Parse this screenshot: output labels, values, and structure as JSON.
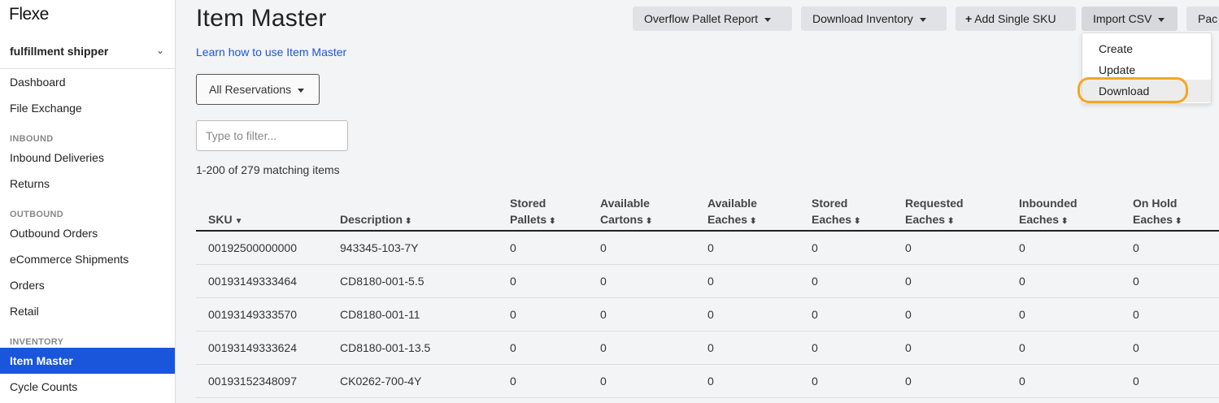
{
  "sidebar": {
    "logo": "Flexe",
    "account": "fulfillment shipper",
    "items_top": [
      "Dashboard",
      "File Exchange"
    ],
    "section_inbound": "INBOUND",
    "items_inbound": [
      "Inbound Deliveries",
      "Returns"
    ],
    "section_outbound": "OUTBOUND",
    "items_outbound": [
      "Outbound Orders",
      "eCommerce Shipments",
      "Orders",
      "Retail"
    ],
    "section_inventory": "INVENTORY",
    "items_inventory": [
      "Item Master",
      "Cycle Counts"
    ]
  },
  "header": {
    "title": "Item Master",
    "help_link": "Learn how to use Item Master"
  },
  "toolbar": {
    "overflow": "Overflow Pallet Report",
    "download_inventory": "Download Inventory",
    "add_sku": "Add Single SKU",
    "import_csv": "Import CSV",
    "truncated": "Pac"
  },
  "import_menu": [
    "Create",
    "Update",
    "Download"
  ],
  "filters": {
    "reservations": "All Reservations",
    "filter_placeholder": "Type to filter...",
    "count_text": "1-200 of 279 matching items"
  },
  "table": {
    "headers": [
      [
        "",
        "SKU"
      ],
      [
        "",
        "Description"
      ],
      [
        "Stored",
        "Pallets"
      ],
      [
        "Available",
        "Cartons"
      ],
      [
        "Available",
        "Eaches"
      ],
      [
        "Stored",
        "Eaches"
      ],
      [
        "Requested",
        "Eaches"
      ],
      [
        "Inbounded",
        "Eaches"
      ],
      [
        "On Hold",
        "Eaches"
      ]
    ],
    "rows": [
      [
        "00192500000000",
        "943345-103-7Y",
        "0",
        "0",
        "0",
        "0",
        "0",
        "0",
        "0"
      ],
      [
        "00193149333464",
        "CD8180-001-5.5",
        "0",
        "0",
        "0",
        "0",
        "0",
        "0",
        "0"
      ],
      [
        "00193149333570",
        "CD8180-001-11",
        "0",
        "0",
        "0",
        "0",
        "0",
        "0",
        "0"
      ],
      [
        "00193149333624",
        "CD8180-001-13.5",
        "0",
        "0",
        "0",
        "0",
        "0",
        "0",
        "0"
      ],
      [
        "00193152348097",
        "CK0262-700-4Y",
        "0",
        "0",
        "0",
        "0",
        "0",
        "0",
        "0"
      ]
    ]
  },
  "colors": {
    "accent": "#1a56db",
    "highlight_ring": "#f5a623"
  }
}
